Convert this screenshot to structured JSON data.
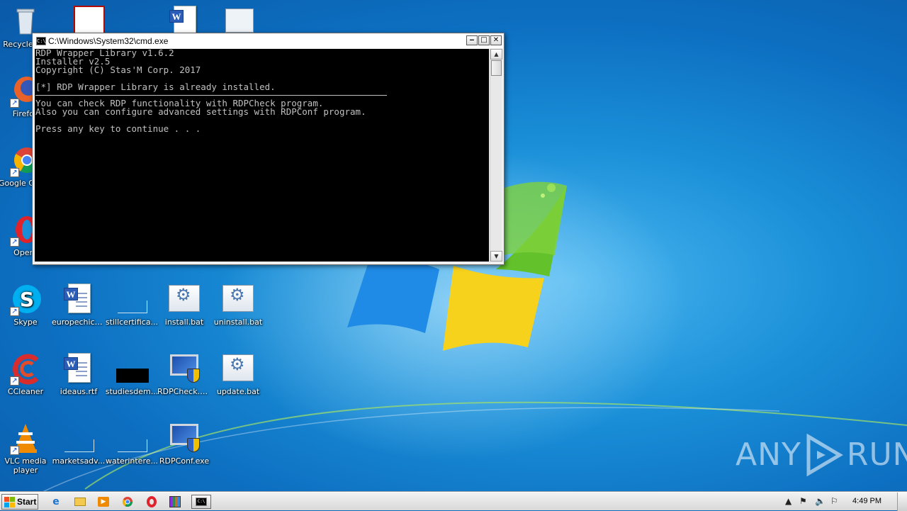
{
  "desktop": {
    "icons": [
      {
        "label": "Recycle Bin"
      },
      {
        "label": "Firefox"
      },
      {
        "label": "Google Chrome"
      },
      {
        "label": "Opera"
      },
      {
        "label": "Skype"
      },
      {
        "label": "CCleaner"
      },
      {
        "label": "VLC media player"
      },
      {
        "label": "europechica..."
      },
      {
        "label": "stillcertifica..."
      },
      {
        "label": "install.bat"
      },
      {
        "label": "uninstall.bat"
      },
      {
        "label": "ideaus.rtf"
      },
      {
        "label": "studiesdem..."
      },
      {
        "label": "RDPCheck.exe"
      },
      {
        "label": "update.bat"
      },
      {
        "label": "marketsadv..."
      },
      {
        "label": "waterintere..."
      },
      {
        "label": "RDPConf.exe"
      }
    ]
  },
  "cmd": {
    "title": "C:\\Windows\\System32\\cmd.exe",
    "lines": [
      "RDP Wrapper Library v1.6.2",
      "Installer v2.5",
      "Copyright (C) Stas'M Corp. 2017",
      "",
      "[*] RDP Wrapper Library is already installed.",
      "",
      "You can check RDP functionality with RDPCheck program.",
      "Also you can configure advanced settings with RDPConf program.",
      "",
      "Press any key to continue . . ."
    ],
    "buttons": {
      "minimize": "0",
      "maximize": "1",
      "close": "r"
    }
  },
  "taskbar": {
    "start_label": "Start",
    "clock": "4:49 PM"
  },
  "watermark": {
    "left": "ANY",
    "right": "RUN"
  }
}
